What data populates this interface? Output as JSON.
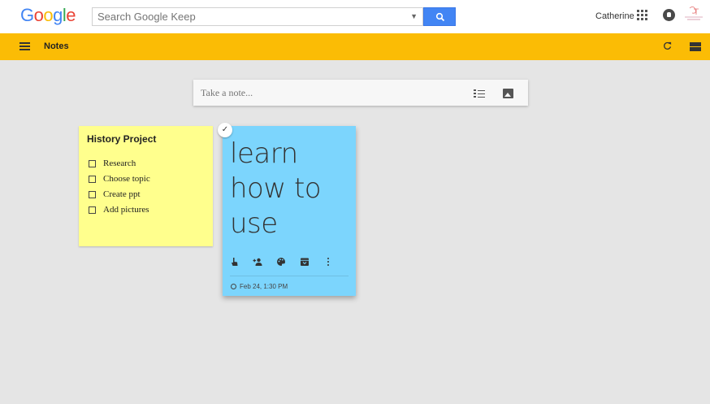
{
  "google_bar": {
    "logo_letters": [
      {
        "char": "G",
        "color": "#4285f4"
      },
      {
        "char": "o",
        "color": "#ea4335"
      },
      {
        "char": "o",
        "color": "#fbbc05"
      },
      {
        "char": "g",
        "color": "#4285f4"
      },
      {
        "char": "l",
        "color": "#34a853"
      },
      {
        "char": "e",
        "color": "#ea4335"
      }
    ],
    "search_placeholder": "Search Google Keep",
    "search_icon": "search-icon",
    "user_name": "Catherine",
    "apps_icon": "apps-grid-icon",
    "notifications_icon": "notifications-icon"
  },
  "app_bar": {
    "color": "#fbbc05",
    "title": "Notes",
    "menu_icon": "menu-icon",
    "refresh_icon": "refresh-icon",
    "view_icon": "view-toggle-icon"
  },
  "composer": {
    "placeholder": "Take a note...",
    "list_icon": "checklist-icon",
    "image_icon": "image-icon"
  },
  "notes": [
    {
      "color": "#ffff8d",
      "title": "History Project",
      "items": [
        "Research",
        "Choose topic",
        "Create ppt",
        "Add pictures"
      ]
    },
    {
      "color": "#7cd5fd",
      "body": "learn how to use",
      "toolbar_icons": [
        "reminder-icon",
        "collaborator-icon",
        "palette-icon",
        "archive-icon",
        "more-icon"
      ],
      "reminder": "Feb 24, 1:30 PM"
    }
  ]
}
